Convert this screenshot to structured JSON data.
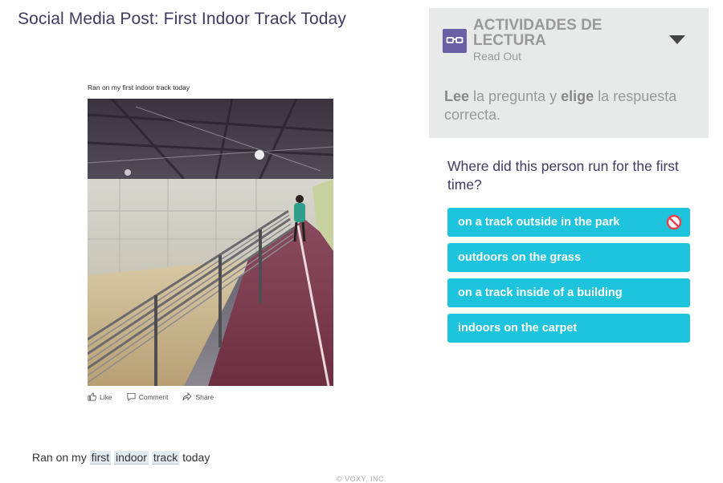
{
  "page": {
    "title": "Social Media Post: First Indoor Track Today"
  },
  "post": {
    "caption": "Ran on my first indoor track today",
    "actions": [
      {
        "icon": "thumbs-up-icon",
        "label": "Like"
      },
      {
        "icon": "comment-icon",
        "label": "Comment"
      },
      {
        "icon": "share-icon",
        "label": "Share"
      }
    ]
  },
  "sentence": {
    "w1": "Ran on my",
    "w2": "first",
    "w3": "indoor",
    "w4": "track",
    "w5": "today"
  },
  "activity": {
    "icon": "reading-glasses-icon",
    "title": "ACTIVIDADES DE LECTURA",
    "subtitle": "Read Out",
    "instr_lee": "Lee",
    "instr_mid": "la pregunta y",
    "instr_elige": "elige",
    "instr_end": "la respuesta correcta."
  },
  "question": "Where did this person run for the first time?",
  "answers": [
    {
      "label": "on a track outside in the park",
      "state": "incorrect"
    },
    {
      "label": "outdoors on the grass"
    },
    {
      "label": "on a track inside of a building"
    },
    {
      "label": "indoors on the carpet"
    }
  ],
  "footer": {
    "copyright": "© VOXY, INC."
  },
  "colors": {
    "accent": "#1ec4dd",
    "title": "#3f3c62",
    "panel": "#e8e9e9",
    "badge": "#6b5fa6",
    "incorrect": "#e8434f"
  }
}
